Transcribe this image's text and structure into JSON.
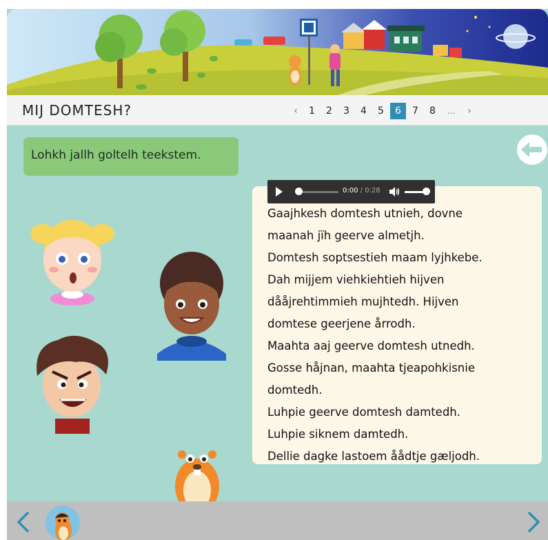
{
  "header": {
    "title": "MIJ DOMTESH?",
    "pager": {
      "prev": "‹",
      "pages": [
        "1",
        "2",
        "3",
        "4",
        "5",
        "6",
        "7",
        "8"
      ],
      "active": "6",
      "ellipsis": "...",
      "next": "›"
    }
  },
  "instruction": "Lohkh jallh goltelh teekstem.",
  "audio": {
    "current": "0:00",
    "separator": " / ",
    "duration": "0:28"
  },
  "text_lines": [
    "Gaajhkesh domtesh utnieh, dovne",
    "maanah jïh geerve almetjh.",
    "Domtesh soptsestieh maam lyjhkebe.",
    "Dah mijjem viehkiehtieh hijven",
    "dååjrehtimmieh mujhtedh.  Hijven",
    "domtese geerjene årrodh.",
    "Maahta aaj geerve domtesh utnedh.",
    "Gosse håjnan, maahta tjeapohkisnie",
    "domtedh.",
    "Luhpie geerve domtesh damtedh.",
    "Luhpie siknem damtedh.",
    "Dellie dagke lastoem åådtje gæljodh."
  ],
  "colors": {
    "background": "#a9d8cf",
    "instruction": "#8bc97a",
    "panel": "#fdf7e8",
    "accent": "#2f8fb2",
    "footer": "#bfbfbf"
  },
  "icons": {
    "back": "arrow-left-circle-icon",
    "prev": "chevron-left-icon",
    "next": "chevron-right-icon",
    "play": "play-icon",
    "volume": "volume-icon"
  }
}
